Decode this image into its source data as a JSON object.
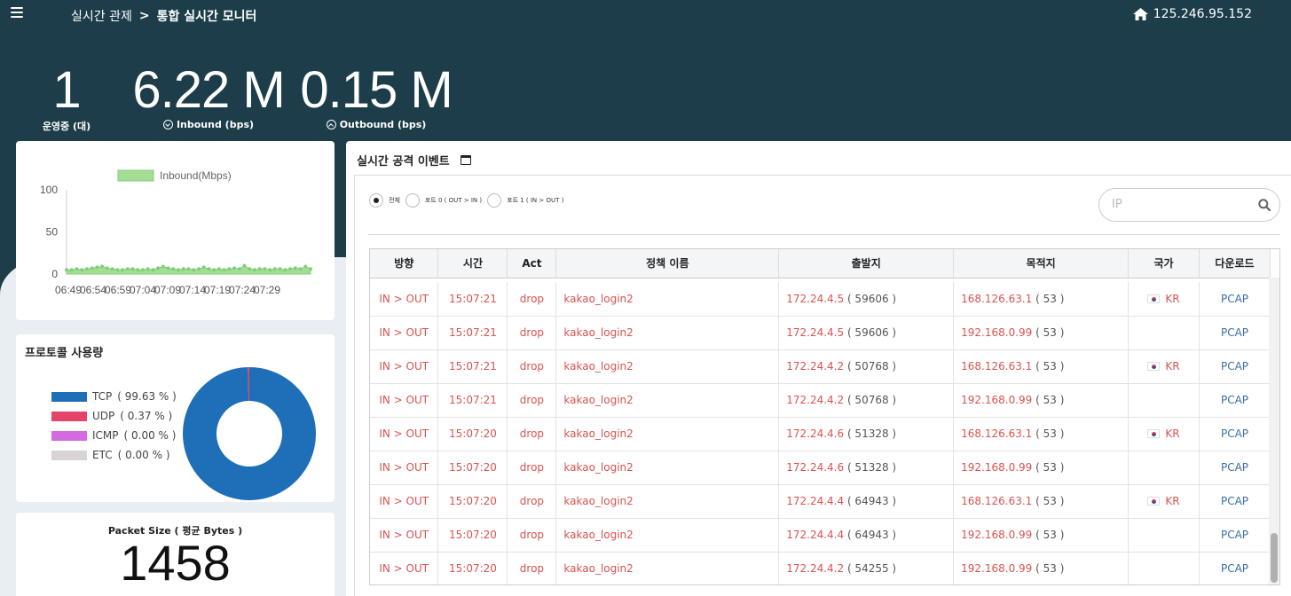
{
  "header": {
    "breadcrumb_parent": "실시간 관제",
    "breadcrumb_sep": ">",
    "breadcrumb_current": "통합 실시간 모니터",
    "ip_address": "125.246.95.152"
  },
  "stats": {
    "running": {
      "value": "1",
      "label": "운영중 (대)"
    },
    "inbound": {
      "value": "6.22 M",
      "label": "Inbound (bps)"
    },
    "outbound": {
      "value": "0.15 M",
      "label": "Outbound (bps)"
    }
  },
  "chart_data": {
    "type": "area",
    "legend": "Inbound(Mbps)",
    "ylim": [
      0,
      100
    ],
    "y_ticks": [
      "100",
      "50",
      "0"
    ],
    "x_ticks": [
      "06:49",
      "06:54",
      "06:59",
      "07:04",
      "07:09",
      "07:14",
      "07:19",
      "07:24",
      "07:29"
    ],
    "values": [
      5,
      5,
      6,
      5,
      6,
      7,
      8,
      9,
      7,
      6,
      5,
      5,
      6,
      6,
      5,
      5,
      6,
      5,
      7,
      9,
      7,
      6,
      5,
      6,
      6,
      5,
      6,
      8,
      6,
      5,
      6,
      5,
      6,
      7,
      6,
      10,
      6,
      5,
      6,
      6,
      5,
      6,
      6,
      5,
      6,
      7,
      6,
      9,
      6
    ],
    "color": "#7ed07a"
  },
  "protocol": {
    "title": "프로토콜 사용량",
    "items": [
      {
        "name": "TCP",
        "pct": "( 99.63 % )",
        "value": 99.63,
        "color": "#1f6fb8"
      },
      {
        "name": "UDP",
        "pct": "( 0.37 % )",
        "value": 0.37,
        "color": "#e5436a"
      },
      {
        "name": "ICMP",
        "pct": "( 0.00 % )",
        "value": 0.0,
        "color": "#d46ae0"
      },
      {
        "name": "ETC",
        "pct": "( 0.00 % )",
        "value": 0.0,
        "color": "#d9d4d4"
      }
    ]
  },
  "packet": {
    "title": "Packet Size ( 평균 Bytes )",
    "value": "1458"
  },
  "events": {
    "title": "실시간 공격 이벤트",
    "radios": [
      "전체",
      "포트 0 ( OUT > IN )",
      "포트 1 ( IN > OUT )"
    ],
    "search_placeholder": "IP",
    "columns": [
      "방향",
      "시간",
      "Act",
      "정책 이름",
      "출발지",
      "목적지",
      "국가",
      "다운로드"
    ],
    "rows": [
      {
        "dir": "IN  >  OUT",
        "time": "15:07:21",
        "act": "drop",
        "policy": "kakao_login2",
        "src": "172.24.4.5",
        "src_port": "( 59606 )",
        "dst": "168.126.63.1",
        "dst_port": "( 53 )",
        "country": "KR",
        "dl": "PCAP"
      },
      {
        "dir": "IN  >  OUT",
        "time": "15:07:21",
        "act": "drop",
        "policy": "kakao_login2",
        "src": "172.24.4.5",
        "src_port": "( 59606 )",
        "dst": "192.168.0.99",
        "dst_port": "( 53 )",
        "country": "",
        "dl": "PCAP"
      },
      {
        "dir": "IN  >  OUT",
        "time": "15:07:21",
        "act": "drop",
        "policy": "kakao_login2",
        "src": "172.24.4.2",
        "src_port": "( 50768 )",
        "dst": "168.126.63.1",
        "dst_port": "( 53 )",
        "country": "KR",
        "dl": "PCAP"
      },
      {
        "dir": "IN  >  OUT",
        "time": "15:07:21",
        "act": "drop",
        "policy": "kakao_login2",
        "src": "172.24.4.2",
        "src_port": "( 50768 )",
        "dst": "192.168.0.99",
        "dst_port": "( 53 )",
        "country": "",
        "dl": "PCAP"
      },
      {
        "dir": "IN  >  OUT",
        "time": "15:07:20",
        "act": "drop",
        "policy": "kakao_login2",
        "src": "172.24.4.6",
        "src_port": "( 51328 )",
        "dst": "168.126.63.1",
        "dst_port": "( 53 )",
        "country": "KR",
        "dl": "PCAP"
      },
      {
        "dir": "IN  >  OUT",
        "time": "15:07:20",
        "act": "drop",
        "policy": "kakao_login2",
        "src": "172.24.4.6",
        "src_port": "( 51328 )",
        "dst": "192.168.0.99",
        "dst_port": "( 53 )",
        "country": "",
        "dl": "PCAP"
      },
      {
        "dir": "IN  >  OUT",
        "time": "15:07:20",
        "act": "drop",
        "policy": "kakao_login2",
        "src": "172.24.4.4",
        "src_port": "( 64943 )",
        "dst": "168.126.63.1",
        "dst_port": "( 53 )",
        "country": "KR",
        "dl": "PCAP"
      },
      {
        "dir": "IN  >  OUT",
        "time": "15:07:20",
        "act": "drop",
        "policy": "kakao_login2",
        "src": "172.24.4.4",
        "src_port": "( 64943 )",
        "dst": "192.168.0.99",
        "dst_port": "( 53 )",
        "country": "",
        "dl": "PCAP"
      },
      {
        "dir": "IN  >  OUT",
        "time": "15:07:20",
        "act": "drop",
        "policy": "kakao_login2",
        "src": "172.24.4.2",
        "src_port": "( 54255 )",
        "dst": "192.168.0.99",
        "dst_port": "( 53 )",
        "country": "",
        "dl": "PCAP"
      }
    ]
  }
}
